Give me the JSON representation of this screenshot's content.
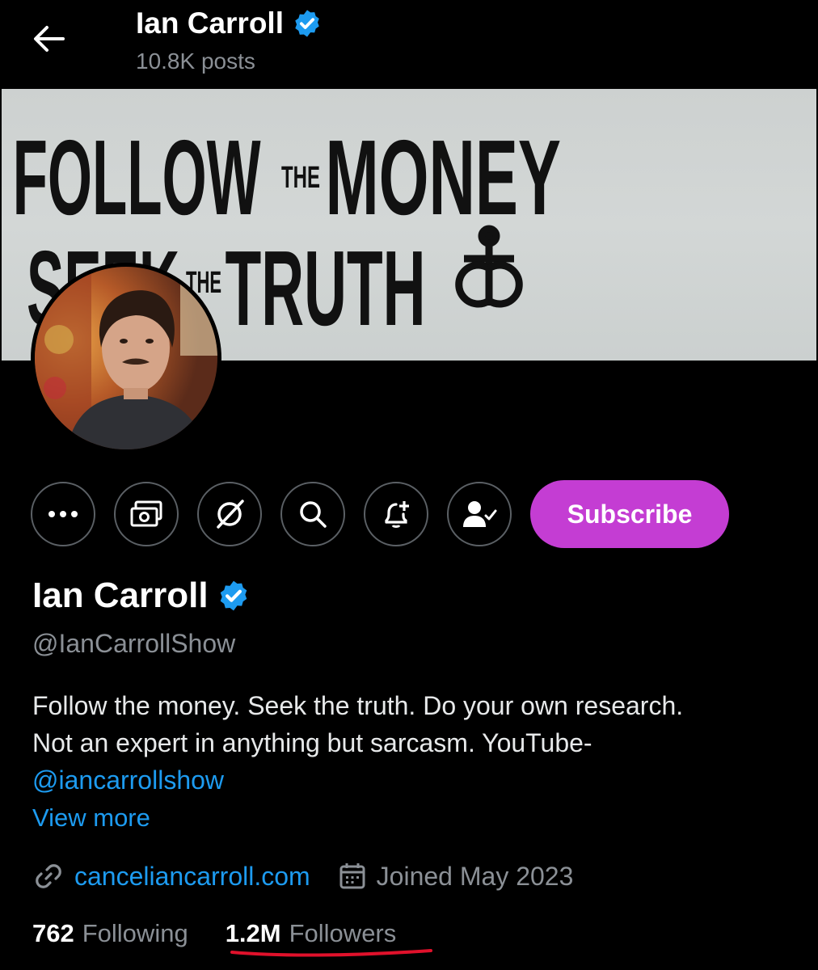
{
  "header": {
    "name": "Ian Carroll",
    "posts": "10.8K posts"
  },
  "banner": {
    "line1_left": "FOLLOW",
    "line1_small": "THE",
    "line1_right": "MONEY",
    "line2_left": "SEEK",
    "line2_small": "THE",
    "line2_right": "TRUTH"
  },
  "actions": {
    "subscribe_label": "Subscribe"
  },
  "profile": {
    "name": "Ian Carroll",
    "handle": "@IanCarrollShow",
    "bio_line1": "Follow the money. Seek the truth. Do your own research.",
    "bio_line2": "Not an expert in anything but sarcasm. YouTube-",
    "bio_link": "@iancarrollshow",
    "view_more": "View more",
    "website": "canceliancarroll.com",
    "joined": "Joined May 2023"
  },
  "stats": {
    "following_count": "762",
    "following_label": "Following",
    "followers_count": "1.2M",
    "followers_label": "Followers"
  },
  "colors": {
    "accent": "#1d9bf0",
    "subscribe": "#c43dd3",
    "underline": "#e0112b"
  },
  "icons": [
    "arrow-left-icon",
    "verified-badge-icon",
    "more-icon",
    "money-icon",
    "grok-icon",
    "search-icon",
    "notification-add-icon",
    "following-person-icon",
    "link-icon",
    "calendar-icon"
  ]
}
